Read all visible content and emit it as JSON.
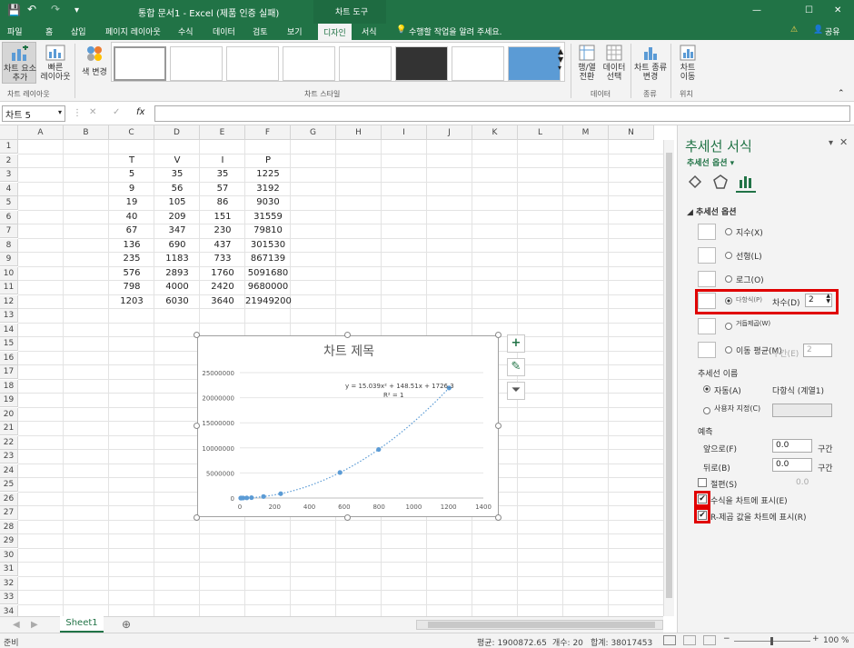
{
  "titlebar": {
    "title": "통합 문서1 - Excel (제품 인증 실패)",
    "chart_tools": "차트 도구",
    "minimize": "—",
    "restore": "☐",
    "close": "✕"
  },
  "tabs": [
    "파일",
    "홈",
    "삽입",
    "페이지 레이아웃",
    "수식",
    "데이터",
    "검토",
    "보기",
    "디자인",
    "서식"
  ],
  "tell_me": "수행할 작업을 알려 주세요.",
  "share": "공유",
  "ribbon": {
    "add_element": "차트 요소\n추가",
    "quick_layout": "빠른\n레이아웃",
    "change_colors": "색 변경",
    "group_layouts": "차트 레이아웃",
    "group_styles": "차트 스타일",
    "switch_row_col": "행/열\n전환",
    "select_data": "데이터\n선택",
    "group_data": "데이터",
    "change_type": "차트 종류\n변경",
    "group_type": "종류",
    "move_chart": "차트\n이동",
    "group_location": "위치"
  },
  "formula_bar": {
    "name_box": "차트 5",
    "fx": "fx"
  },
  "columns": [
    "A",
    "B",
    "C",
    "D",
    "E",
    "F",
    "G",
    "H",
    "I",
    "J",
    "K",
    "L",
    "M",
    "N"
  ],
  "rows": [
    "1",
    "2",
    "3",
    "4",
    "5",
    "6",
    "7",
    "8",
    "9",
    "10",
    "11",
    "12",
    "13",
    "14",
    "15",
    "16",
    "17",
    "18",
    "19",
    "20",
    "21",
    "22",
    "23",
    "24",
    "25",
    "26",
    "27",
    "28",
    "29",
    "30",
    "31",
    "32",
    "33",
    "34"
  ],
  "table": {
    "headers": [
      "T",
      "V",
      "I",
      "P"
    ],
    "data": [
      [
        "5",
        "35",
        "35",
        "1225"
      ],
      [
        "9",
        "56",
        "57",
        "3192"
      ],
      [
        "19",
        "105",
        "86",
        "9030"
      ],
      [
        "40",
        "209",
        "151",
        "31559"
      ],
      [
        "67",
        "347",
        "230",
        "79810"
      ],
      [
        "136",
        "690",
        "437",
        "301530"
      ],
      [
        "235",
        "1183",
        "733",
        "867139"
      ],
      [
        "576",
        "2893",
        "1760",
        "5091680"
      ],
      [
        "798",
        "4000",
        "2420",
        "9680000"
      ],
      [
        "1203",
        "6030",
        "3640",
        "21949200"
      ]
    ]
  },
  "chart_data": {
    "type": "scatter",
    "title": "차트 제목",
    "x": [
      5,
      9,
      19,
      40,
      67,
      136,
      235,
      576,
      798,
      1203
    ],
    "y": [
      1225,
      3192,
      9030,
      31559,
      79810,
      301530,
      867139,
      5091680,
      9680000,
      21949200
    ],
    "xlim": [
      0,
      1400
    ],
    "ylim": [
      0,
      25000000
    ],
    "x_ticks": [
      "0",
      "200",
      "400",
      "600",
      "800",
      "1000",
      "1200",
      "1400"
    ],
    "y_ticks": [
      "0",
      "5000000",
      "10000000",
      "15000000",
      "20000000",
      "25000000"
    ],
    "trendline": "polynomial order 2, dotted",
    "equation": "y = 15.039x² + 148.51x + 1726.3",
    "r_squared": "R² = 1",
    "grid": "horizontal",
    "color": "#5b9bd5"
  },
  "sheet_tab": "Sheet1",
  "status": {
    "ready": "준비",
    "average": "평균: 1900872.65",
    "count": "개수: 20",
    "sum": "합계: 38017453",
    "zoom": "100 %"
  },
  "pane": {
    "title": "추세선 서식",
    "subtitle": "추세선 옵션 ▾",
    "section": "◢ 추세선 옵션",
    "options": [
      "지수(X)",
      "선형(L)",
      "로그(O)",
      "다항식(P)",
      "거듭제곱(W)",
      "이동 평균(M)"
    ],
    "order_label": "차수(D)",
    "order_value": "2",
    "period_label": "구간(E)",
    "period_value": "2",
    "name_label": "추세선 이름",
    "auto": "자동(A)",
    "auto_value": "다항식 (계열1)",
    "custom": "사용자 지정(C)",
    "forecast": "예측",
    "forward": "앞으로(F)",
    "forward_value": "0.0",
    "backward": "뒤로(B)",
    "backward_value": "0.0",
    "unit": "구간",
    "intercept": "절편(S)",
    "intercept_value": "0.0",
    "show_equation": "수식을 차트에 표시(E)",
    "show_r2": "R-제곱 값을 차트에 표시(R)"
  }
}
